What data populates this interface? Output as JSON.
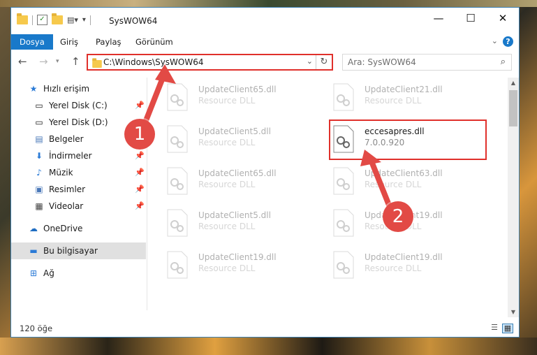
{
  "window": {
    "title": "SysWOW64",
    "minimize": "—",
    "maximize": "☐",
    "close": "✕"
  },
  "ribbon": {
    "tabs": [
      "Dosya",
      "Giriş",
      "Paylaş",
      "Görünüm"
    ],
    "active_tab": "Dosya"
  },
  "nav": {
    "back": "←",
    "forward": "→",
    "up": "↑",
    "address": "C:\\Windows\\SysWOW64",
    "search_placeholder": "Ara: SysWOW64"
  },
  "sidebar": {
    "items": [
      {
        "label": "Hızlı erişim",
        "icon": "star-icon",
        "pinned": false
      },
      {
        "label": "Yerel Disk (C:)",
        "icon": "drive-icon",
        "pinned": true
      },
      {
        "label": "Yerel Disk (D:)",
        "icon": "drive-icon",
        "pinned": false
      },
      {
        "label": "Belgeler",
        "icon": "documents-icon",
        "pinned": true
      },
      {
        "label": "İndirmeler",
        "icon": "download-icon",
        "pinned": true
      },
      {
        "label": "Müzik",
        "icon": "music-icon",
        "pinned": true
      },
      {
        "label": "Resimler",
        "icon": "pictures-icon",
        "pinned": true
      },
      {
        "label": "Videolar",
        "icon": "video-icon",
        "pinned": true
      },
      {
        "label": "OneDrive",
        "icon": "cloud-icon",
        "pinned": false
      },
      {
        "label": "Bu bilgisayar",
        "icon": "computer-icon",
        "pinned": false
      },
      {
        "label": "Ağ",
        "icon": "network-icon",
        "pinned": false
      }
    ],
    "selected": "Bu bilgisayar"
  },
  "files": [
    {
      "name": "UpdateClient65.dll",
      "desc": "Resource DLL"
    },
    {
      "name": "UpdateClient21.dll",
      "desc": "Resource DLL"
    },
    {
      "name": "UpdateClient5.dll",
      "desc": "Resource DLL"
    },
    {
      "name": "eccesapres.dll",
      "desc": "7.0.0.920"
    },
    {
      "name": "UpdateClient65.dll",
      "desc": "Resource DLL"
    },
    {
      "name": "UpdateClient63.dll",
      "desc": "Resource DLL"
    },
    {
      "name": "UpdateClient5.dll",
      "desc": "Resource DLL"
    },
    {
      "name": "UpdateClient19.dll",
      "desc": "Resource DLL"
    },
    {
      "name": "UpdateClient19.dll",
      "desc": "Resource DLL"
    },
    {
      "name": "UpdateClient19.dll",
      "desc": "Resource DLL"
    }
  ],
  "status": {
    "item_count": "120 öğe"
  },
  "annotations": {
    "step1": "1",
    "step2": "2",
    "accent_color": "#e0302b"
  }
}
